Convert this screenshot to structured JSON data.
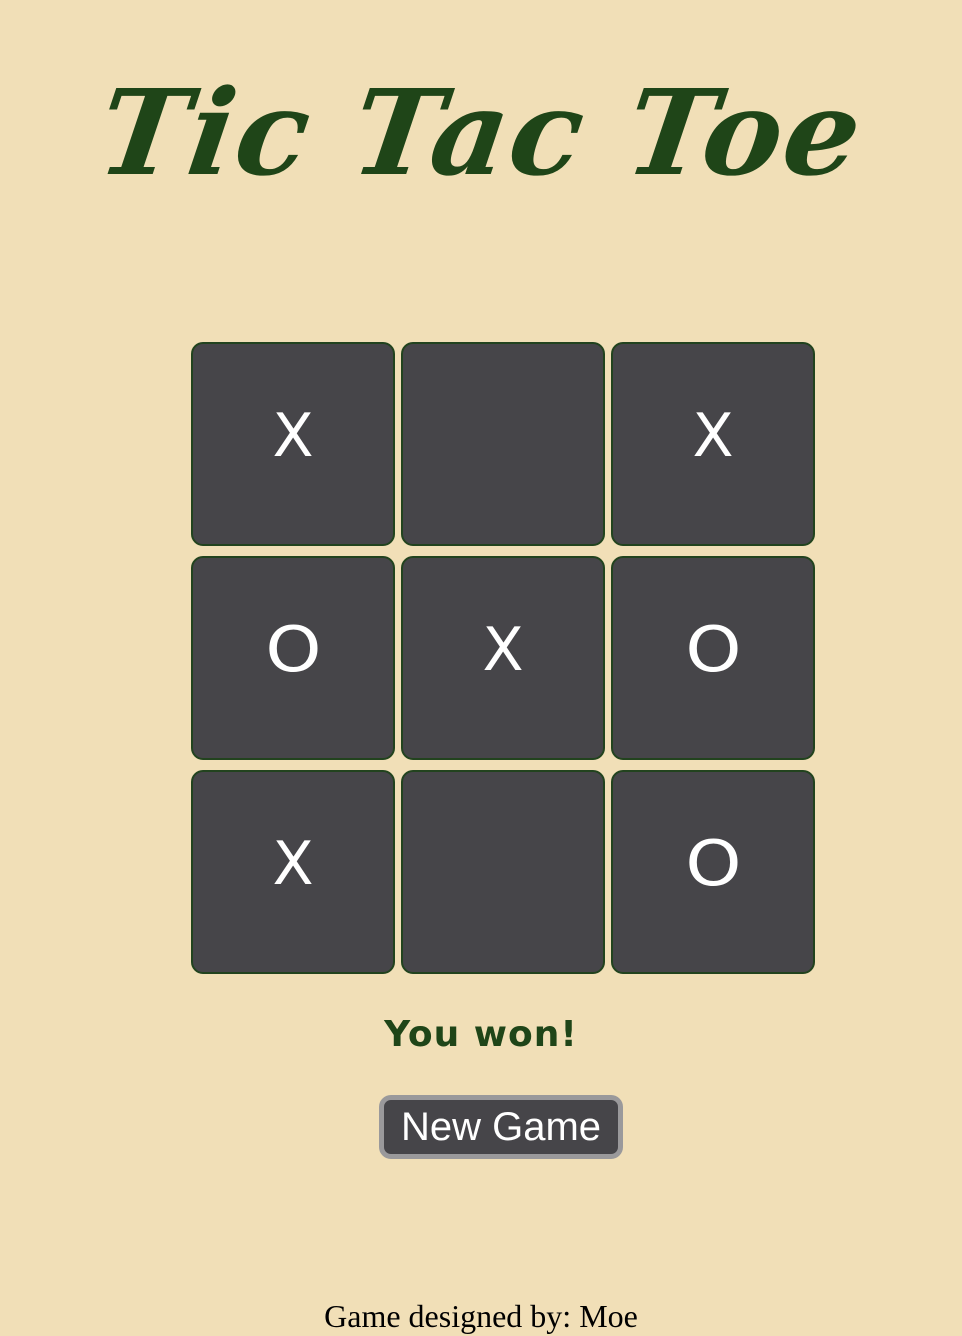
{
  "header": {
    "title": "Tic Tac Toe"
  },
  "board": {
    "cells": [
      "X",
      "",
      "X",
      "O",
      "X",
      "O",
      "X",
      "",
      "O"
    ]
  },
  "status": {
    "message": "You won!"
  },
  "controls": {
    "new_game_label": "New Game"
  },
  "footer": {
    "credit": "Game designed by: Moe"
  },
  "colors": {
    "background": "#f1dfb7",
    "title": "#1f4518",
    "cell": "#464549",
    "cell_border": "#22431e",
    "mark": "#ffffff",
    "button_border": "#9a999b"
  }
}
